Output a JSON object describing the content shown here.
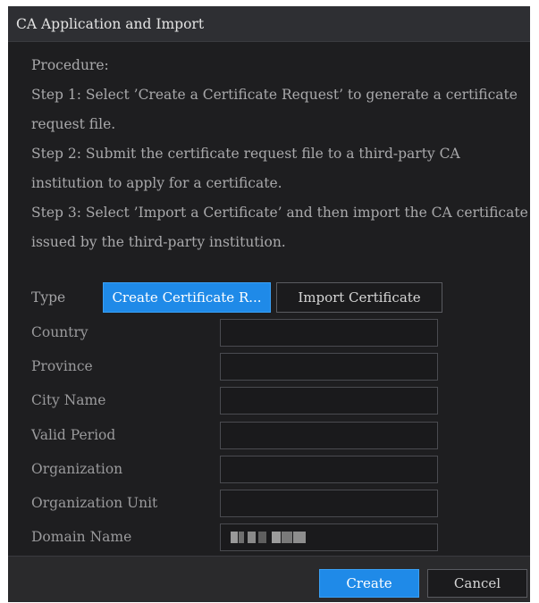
{
  "dialog": {
    "title": "CA Application and Import"
  },
  "procedure": {
    "lines": [
      "Procedure:",
      " Step 1: Select ’Create a Certificate Request’ to generate a certificate",
      "request file.",
      " Step 2: Submit the certificate request file to a third-party CA",
      "institution to apply for a certificate.",
      " Step 3: Select ’Import a Certificate’ and then import the CA certificate",
      "issued by the third-party institution."
    ]
  },
  "type": {
    "label": "Type",
    "options": [
      "Create Certificate R...",
      "Import Certificate"
    ],
    "selected": "Create Certificate R..."
  },
  "fields": [
    {
      "label": "Country",
      "value": ""
    },
    {
      "label": "Province",
      "value": ""
    },
    {
      "label": "City Name",
      "value": ""
    },
    {
      "label": "Valid Period",
      "value": ""
    },
    {
      "label": "Organization",
      "value": ""
    },
    {
      "label": "Organization Unit",
      "value": ""
    },
    {
      "label": "Domain Name",
      "value": ""
    }
  ],
  "footer": {
    "create_label": "Create",
    "cancel_label": "Cancel"
  },
  "colors": {
    "accent": "#1f8ae8",
    "dialog_bg": "#1e1e20",
    "titlebar_bg": "#2e2f33"
  }
}
